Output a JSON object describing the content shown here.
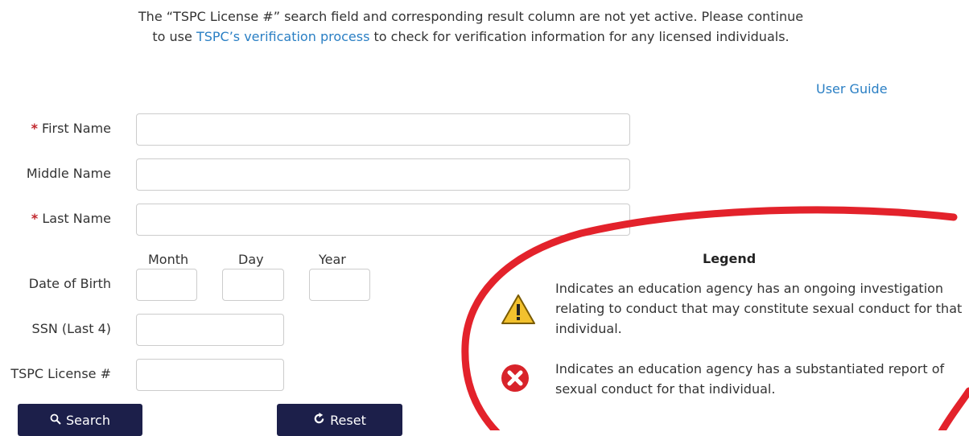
{
  "notice": {
    "before": "The “TSPC License #” search field and corresponding result column are not yet active. Please continue to use ",
    "link": "TSPC’s verification process",
    "after": " to check for verification information for any licensed individuals."
  },
  "user_guide": "User Guide",
  "form": {
    "required_mark": "*",
    "first_name_label": "First Name",
    "middle_name_label": "Middle Name",
    "last_name_label": "Last Name",
    "dob_label": "Date of Birth",
    "dob_month": "Month",
    "dob_day": "Day",
    "dob_year": "Year",
    "ssn_label": "SSN (Last 4)",
    "tspc_label": "TSPC License #",
    "values": {
      "first": "",
      "middle": "",
      "last": "",
      "month": "",
      "day": "",
      "year": "",
      "ssn": "",
      "tspc": ""
    }
  },
  "buttons": {
    "search": "Search",
    "reset": "Reset"
  },
  "legend": {
    "title": "Legend",
    "warning_text": "Indicates an education agency has an ongoing investigation relating to conduct that may constitute sexual conduct for that individual.",
    "error_text": "Indicates an education agency has a substantiated report of sexual conduct for that individual."
  },
  "colors": {
    "link": "#2a7fc4",
    "required": "#c0262c",
    "button": "#1c1f4a",
    "warning": "#f2c12e",
    "error": "#d8232a",
    "annotation": "#e3222b"
  },
  "icons": {
    "search": "magnifier-icon",
    "reset": "refresh-icon",
    "warning": "warning-triangle-icon",
    "error": "error-x-icon"
  }
}
